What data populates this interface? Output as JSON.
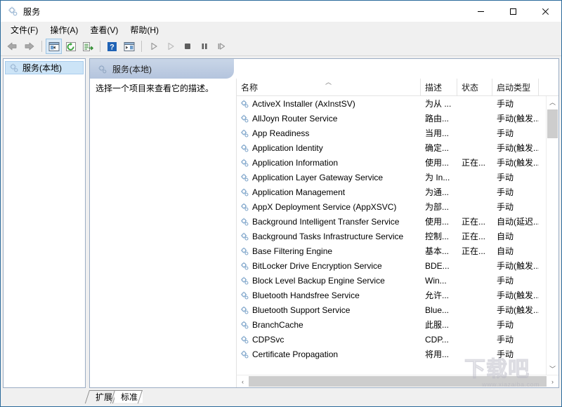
{
  "window": {
    "title": "服务",
    "icon": "services-gear-icon",
    "minimize_label": "最小化",
    "maximize_label": "最大化",
    "close_label": "关闭"
  },
  "menubar": {
    "items": [
      {
        "label": "文件(F)",
        "name": "menu-file"
      },
      {
        "label": "操作(A)",
        "name": "menu-action"
      },
      {
        "label": "查看(V)",
        "name": "menu-view"
      },
      {
        "label": "帮助(H)",
        "name": "menu-help"
      }
    ]
  },
  "toolbar": {
    "buttons": [
      {
        "name": "back-button",
        "icon": "arrow-left-icon",
        "active": false
      },
      {
        "name": "forward-button",
        "icon": "arrow-right-icon",
        "active": false
      },
      {
        "name": "show-hide-tree-button",
        "icon": "console-tree-icon",
        "active": true
      },
      {
        "name": "refresh-button",
        "icon": "refresh-icon",
        "active": false
      },
      {
        "name": "export-list-button",
        "icon": "export-list-icon",
        "active": false
      },
      {
        "name": "help-button",
        "icon": "question-mark-icon",
        "active": false
      },
      {
        "name": "properties-button",
        "icon": "window-properties-icon",
        "active": false
      },
      {
        "name": "start-service-button",
        "icon": "play-icon",
        "active": false
      },
      {
        "name": "start-all-button",
        "icon": "play-outline-icon",
        "active": false
      },
      {
        "name": "stop-service-button",
        "icon": "stop-icon",
        "active": false
      },
      {
        "name": "pause-service-button",
        "icon": "pause-icon",
        "active": false
      },
      {
        "name": "restart-service-button",
        "icon": "restart-icon",
        "active": false
      }
    ]
  },
  "tree": {
    "items": [
      {
        "label": "服务(本地)",
        "icon": "services-gear-icon",
        "selected": true
      }
    ]
  },
  "pane": {
    "header_title": "服务(本地)",
    "header_icon": "services-gear-icon",
    "detail_hint": "选择一个项目来查看它的描述。"
  },
  "list": {
    "columns": [
      {
        "label": "名称",
        "key": "name",
        "sorted": "asc",
        "sort_caret": "︿"
      },
      {
        "label": "描述",
        "key": "description",
        "sorted": ""
      },
      {
        "label": "状态",
        "key": "status",
        "sorted": ""
      },
      {
        "label": "启动类型",
        "key": "startup",
        "sorted": ""
      },
      {
        "label": "",
        "key": "logon",
        "sorted": ""
      }
    ],
    "rows": [
      {
        "name": "ActiveX Installer (AxInstSV)",
        "description": "为从 ...",
        "status": "",
        "startup": "手动",
        "icon": "service-gear-icon"
      },
      {
        "name": "AllJoyn Router Service",
        "description": "路由...",
        "status": "",
        "startup": "手动(触发...",
        "icon": "service-gear-icon"
      },
      {
        "name": "App Readiness",
        "description": "当用...",
        "status": "",
        "startup": "手动",
        "icon": "service-gear-icon"
      },
      {
        "name": "Application Identity",
        "description": "确定...",
        "status": "",
        "startup": "手动(触发...",
        "icon": "service-gear-icon"
      },
      {
        "name": "Application Information",
        "description": "使用...",
        "status": "正在...",
        "startup": "手动(触发...",
        "icon": "service-gear-icon"
      },
      {
        "name": "Application Layer Gateway Service",
        "description": "为 In...",
        "status": "",
        "startup": "手动",
        "icon": "service-gear-icon"
      },
      {
        "name": "Application Management",
        "description": "为通...",
        "status": "",
        "startup": "手动",
        "icon": "service-gear-icon"
      },
      {
        "name": "AppX Deployment Service (AppXSVC)",
        "description": "为部...",
        "status": "",
        "startup": "手动",
        "icon": "service-gear-icon"
      },
      {
        "name": "Background Intelligent Transfer Service",
        "description": "使用...",
        "status": "正在...",
        "startup": "自动(延迟...",
        "icon": "service-gear-icon"
      },
      {
        "name": "Background Tasks Infrastructure Service",
        "description": "控制...",
        "status": "正在...",
        "startup": "自动",
        "icon": "service-gear-icon"
      },
      {
        "name": "Base Filtering Engine",
        "description": "基本...",
        "status": "正在...",
        "startup": "自动",
        "icon": "service-gear-icon"
      },
      {
        "name": "BitLocker Drive Encryption Service",
        "description": "BDE...",
        "status": "",
        "startup": "手动(触发...",
        "icon": "service-gear-icon"
      },
      {
        "name": "Block Level Backup Engine Service",
        "description": "Win...",
        "status": "",
        "startup": "手动",
        "icon": "service-gear-icon"
      },
      {
        "name": "Bluetooth Handsfree Service",
        "description": "允许...",
        "status": "",
        "startup": "手动(触发...",
        "icon": "service-gear-icon"
      },
      {
        "name": "Bluetooth Support Service",
        "description": "Blue...",
        "status": "",
        "startup": "手动(触发...",
        "icon": "service-gear-icon"
      },
      {
        "name": "BranchCache",
        "description": "此服...",
        "status": "",
        "startup": "手动",
        "icon": "service-gear-icon"
      },
      {
        "name": "CDPSvc",
        "description": "CDP...",
        "status": "",
        "startup": "手动",
        "icon": "service-gear-icon"
      },
      {
        "name": "Certificate Propagation",
        "description": "将用...",
        "status": "",
        "startup": "手动",
        "icon": "service-gear-icon"
      }
    ]
  },
  "scrollbars": {
    "vertical_up": "︿",
    "vertical_down": "﹀",
    "horizontal_left": "‹",
    "horizontal_right": "›"
  },
  "tabs": [
    {
      "label": "扩展",
      "selected": false,
      "name": "tab-extended"
    },
    {
      "label": "标准",
      "selected": true,
      "name": "tab-standard"
    }
  ],
  "watermark": {
    "text": "下载吧",
    "url": "www.xiazaiba.com"
  }
}
